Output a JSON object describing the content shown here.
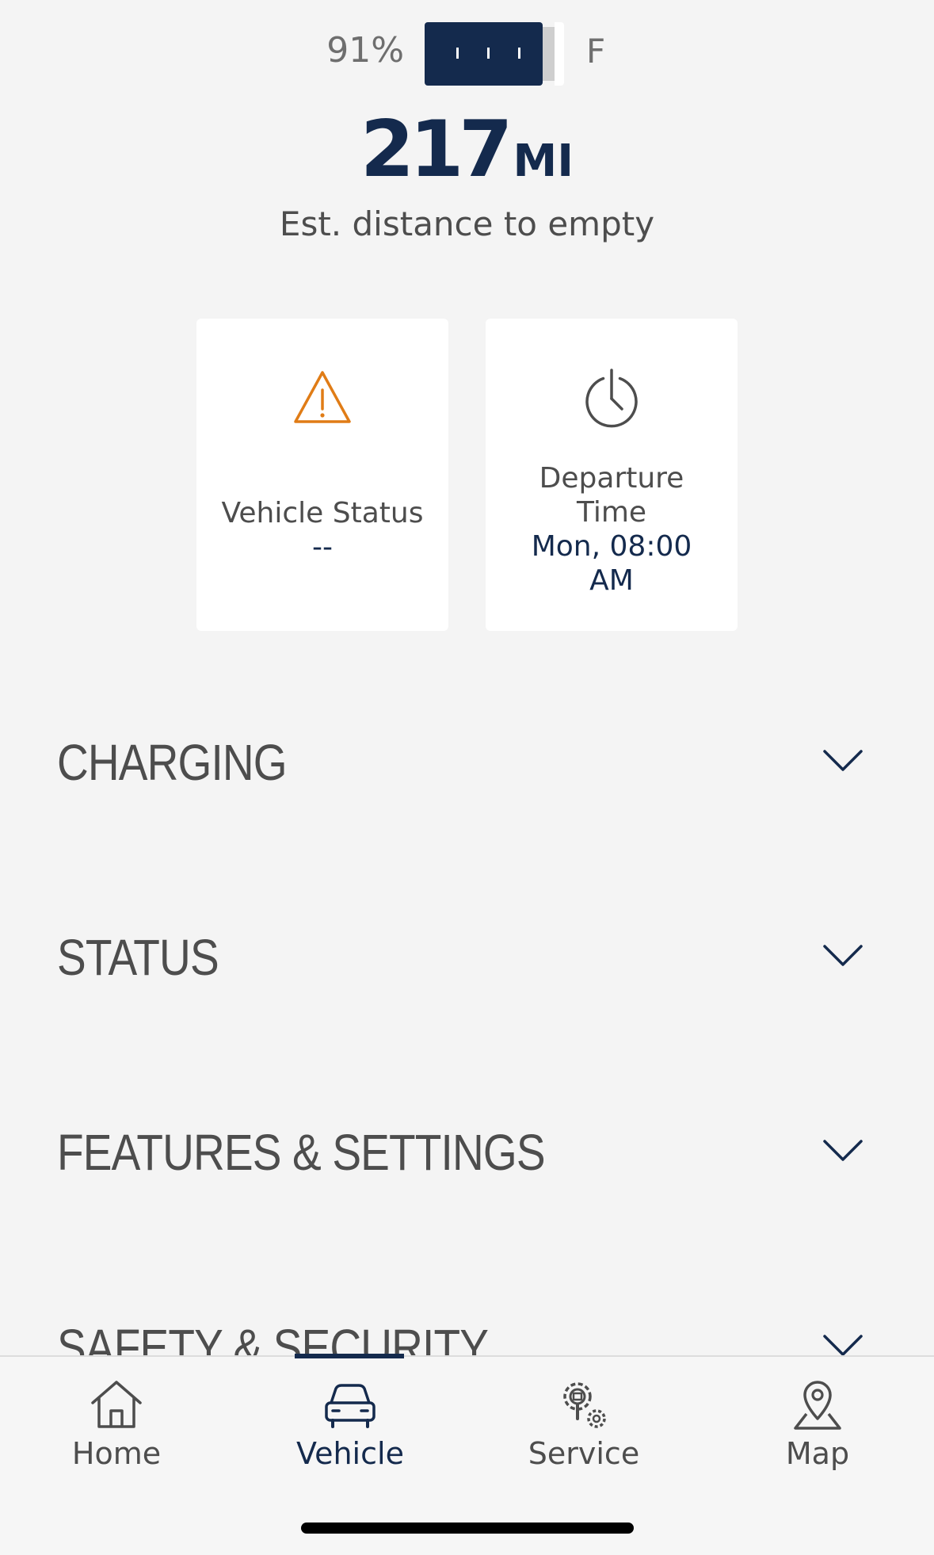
{
  "battery": {
    "percent_label": "91%",
    "level_percent": 91,
    "full_label": "F",
    "fill_color": "#142a4d"
  },
  "range": {
    "value": "217",
    "unit": "MI",
    "caption": "Est. distance to empty"
  },
  "cards": {
    "vehicle_status": {
      "icon": "warning-triangle-icon",
      "label": "Vehicle Status",
      "value": "--",
      "icon_color": "#e07c16"
    },
    "departure_time": {
      "icon": "power-clock-icon",
      "label_line1": "Departure",
      "label_line2": "Time",
      "value_line1": "Mon, 08:00",
      "value_line2": "AM"
    }
  },
  "sections": {
    "charging": "CHARGING",
    "status": "STATUS",
    "features": "FEATURES & SETTINGS",
    "safety": "SAFETY & SECURITY"
  },
  "tabs": {
    "home": {
      "label": "Home",
      "icon": "home-icon"
    },
    "vehicle": {
      "label": "Vehicle",
      "icon": "car-icon",
      "active": true
    },
    "service": {
      "label": "Service",
      "icon": "service-gears-icon"
    },
    "map": {
      "label": "Map",
      "icon": "map-pin-icon"
    }
  },
  "colors": {
    "primary": "#142a4d",
    "text": "#4d4d4d",
    "background": "#f4f4f4",
    "warning": "#e07c16"
  }
}
